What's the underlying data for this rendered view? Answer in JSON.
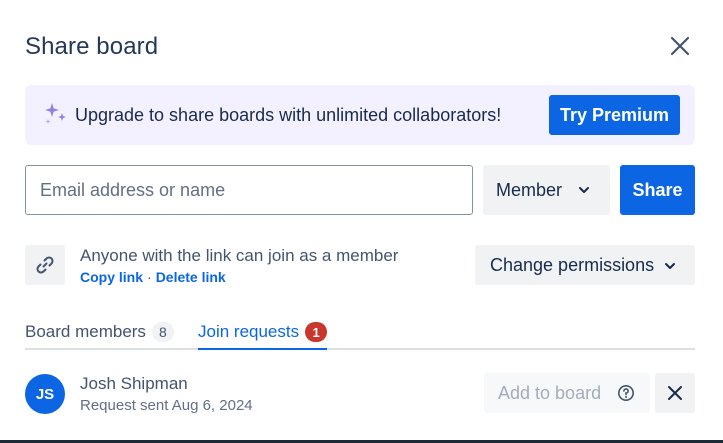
{
  "dialog": {
    "title": "Share board"
  },
  "banner": {
    "text": "Upgrade to share boards with unlimited collaborators!",
    "button_label": "Try Premium"
  },
  "invite": {
    "placeholder": "Email address or name",
    "value": "",
    "role_selected": "Member",
    "share_label": "Share"
  },
  "link_section": {
    "text": "Anyone with the link can join as a member",
    "copy_link": "Copy link",
    "separator": "·",
    "delete_link": "Delete link",
    "change_permissions": "Change permissions"
  },
  "tabs": [
    {
      "label": "Board members",
      "count": "8",
      "active": false
    },
    {
      "label": "Join requests",
      "count": "1",
      "active": true
    }
  ],
  "requests": [
    {
      "initials": "JS",
      "name": "Josh Shipman",
      "status": "Request sent Aug 6, 2024",
      "add_label": "Add to board"
    }
  ],
  "colors": {
    "primary": "#0c66e4",
    "banner_bg": "#f3f0ff",
    "neutral_button": "#f1f2f4",
    "badge_red": "#c9372c"
  }
}
